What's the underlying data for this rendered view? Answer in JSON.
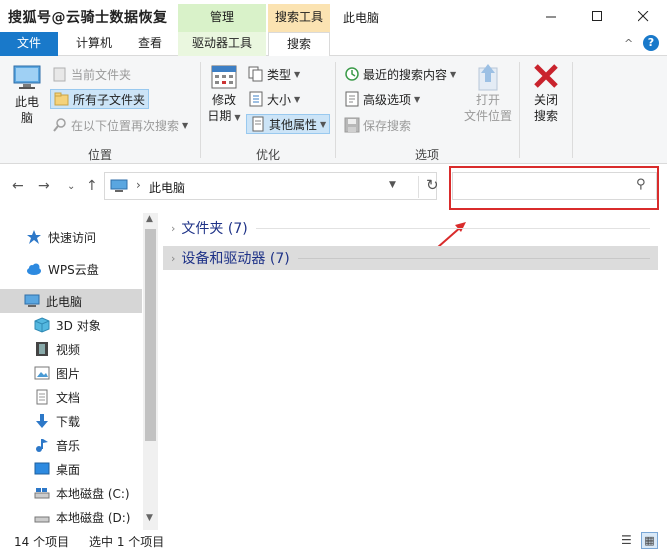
{
  "titlebar": {
    "watermark": "搜狐号@云骑士数据恢复",
    "context_manage": "管理",
    "context_search": "搜索工具",
    "window_title": "此电脑"
  },
  "tabs": {
    "file": "文件",
    "computer": "计算机",
    "view": "查看",
    "drive_tools": "驱动器工具",
    "search": "搜索"
  },
  "ribbon": {
    "location": {
      "this_pc": "此电脑",
      "current_folder": "当前文件夹",
      "all_subfolders": "所有子文件夹",
      "search_again_in": "在以下位置再次搜索",
      "group_label": "位置"
    },
    "refine": {
      "modified_date_line1": "修改",
      "modified_date_line2": "日期",
      "kind": "类型",
      "size": "大小",
      "other_props": "其他属性",
      "group_label": "优化"
    },
    "options": {
      "recent_searches": "最近的搜索内容",
      "advanced_options": "高级选项",
      "save_search": "保存搜索",
      "open_location_line1": "打开",
      "open_location_line2": "文件位置",
      "group_label": "选项"
    },
    "close": {
      "line1": "关闭",
      "line2": "搜索"
    }
  },
  "address": {
    "path": "此电脑",
    "search_placeholder": ""
  },
  "nav": {
    "items": [
      {
        "label": "快速访问",
        "icon": "star-icon"
      },
      {
        "label": "WPS云盘",
        "icon": "cloud-icon"
      },
      {
        "label": "此电脑",
        "icon": "pc-icon"
      },
      {
        "label": "3D 对象",
        "icon": "cube-icon"
      },
      {
        "label": "视频",
        "icon": "video-icon"
      },
      {
        "label": "图片",
        "icon": "picture-icon"
      },
      {
        "label": "文档",
        "icon": "document-icon"
      },
      {
        "label": "下载",
        "icon": "download-icon"
      },
      {
        "label": "音乐",
        "icon": "music-icon"
      },
      {
        "label": "桌面",
        "icon": "desktop-icon"
      },
      {
        "label": "本地磁盘 (C:)",
        "icon": "drive-icon"
      },
      {
        "label": "本地磁盘 (D:)",
        "icon": "drive-icon"
      }
    ]
  },
  "content": {
    "folders_header": "文件夹 (7)",
    "devices_header": "设备和驱动器 (7)"
  },
  "status": {
    "item_count": "14 个项目",
    "selected": "选中 1 个项目"
  },
  "colors": {
    "accent": "#1979ca",
    "annotation_red": "#d92b2b",
    "group_header_blue": "#1e3287"
  }
}
